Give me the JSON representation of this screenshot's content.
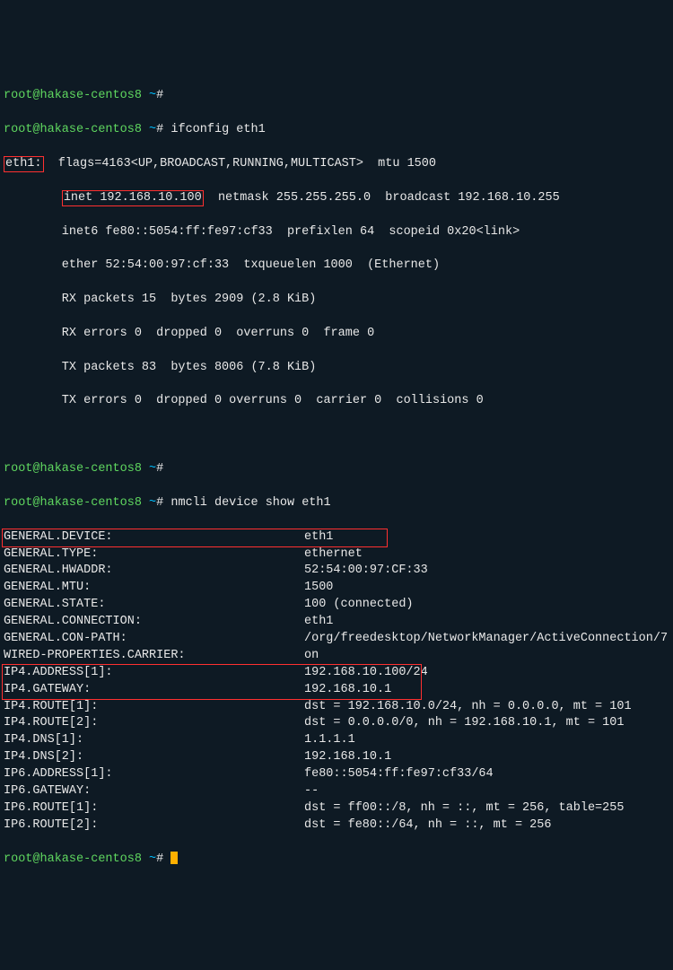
{
  "prompt": {
    "userhost": "root@hakase-centos8",
    "tilde": "~",
    "hash": "#"
  },
  "cmd1": "ifconfig eth1",
  "ifconfig": {
    "iface": "eth1:",
    "flags": "  flags=4163<UP,BROADCAST,RUNNING,MULTICAST>  mtu 1500",
    "inet_box": "inet 192.168.10.100",
    "inet_rest": "  netmask 255.255.255.0  broadcast 192.168.10.255",
    "inet6": "        inet6 fe80::5054:ff:fe97:cf33  prefixlen 64  scopeid 0x20<link>",
    "ether": "        ether 52:54:00:97:cf:33  txqueuelen 1000  (Ethernet)",
    "rxp": "        RX packets 15  bytes 2909 (2.8 KiB)",
    "rxe": "        RX errors 0  dropped 0  overruns 0  frame 0",
    "txp": "        TX packets 83  bytes 8006 (7.8 KiB)",
    "txe": "        TX errors 0  dropped 0 overruns 0  carrier 0  collisions 0"
  },
  "cmd2": "nmcli device show eth1",
  "nmcli": [
    {
      "k": "GENERAL.DEVICE:",
      "v": "eth1"
    },
    {
      "k": "GENERAL.TYPE:",
      "v": "ethernet"
    },
    {
      "k": "GENERAL.HWADDR:",
      "v": "52:54:00:97:CF:33"
    },
    {
      "k": "GENERAL.MTU:",
      "v": "1500"
    },
    {
      "k": "GENERAL.STATE:",
      "v": "100 (connected)"
    },
    {
      "k": "GENERAL.CONNECTION:",
      "v": "eth1"
    },
    {
      "k": "GENERAL.CON-PATH:",
      "v": "/org/freedesktop/NetworkManager/ActiveConnection/7"
    },
    {
      "k": "WIRED-PROPERTIES.CARRIER:",
      "v": "on"
    },
    {
      "k": "IP4.ADDRESS[1]:",
      "v": "192.168.10.100/24"
    },
    {
      "k": "IP4.GATEWAY:",
      "v": "192.168.10.1"
    },
    {
      "k": "IP4.ROUTE[1]:",
      "v": "dst = 192.168.10.0/24, nh = 0.0.0.0, mt = 101"
    },
    {
      "k": "IP4.ROUTE[2]:",
      "v": "dst = 0.0.0.0/0, nh = 192.168.10.1, mt = 101"
    },
    {
      "k": "IP4.DNS[1]:",
      "v": "1.1.1.1"
    },
    {
      "k": "IP4.DNS[2]:",
      "v": "192.168.10.1"
    },
    {
      "k": "IP6.ADDRESS[1]:",
      "v": "fe80::5054:ff:fe97:cf33/64"
    },
    {
      "k": "IP6.GATEWAY:",
      "v": "--"
    },
    {
      "k": "IP6.ROUTE[1]:",
      "v": "dst = ff00::/8, nh = ::, mt = 256, table=255"
    },
    {
      "k": "IP6.ROUTE[2]:",
      "v": "dst = fe80::/64, nh = ::, mt = 256"
    }
  ]
}
